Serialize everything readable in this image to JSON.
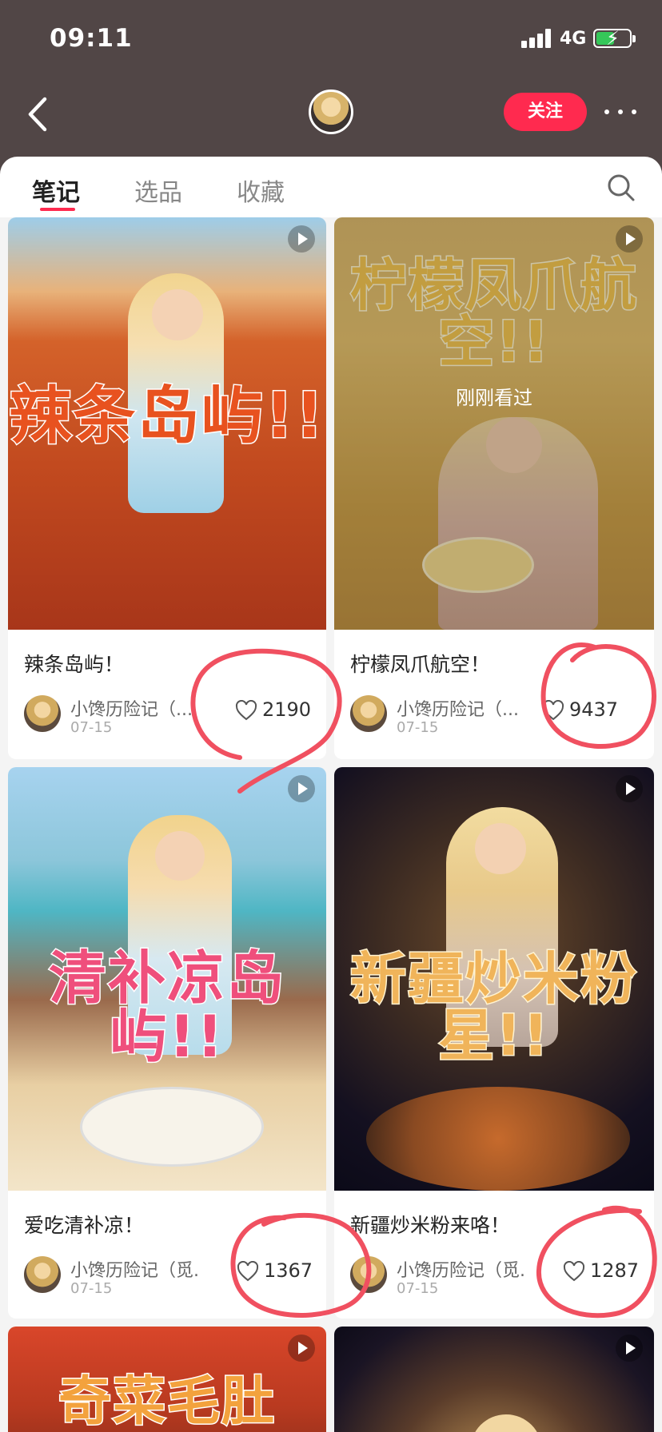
{
  "status_bar": {
    "time": "09:11",
    "network": "4G"
  },
  "header": {
    "follow_label": "关注"
  },
  "tabs": [
    {
      "label": "笔记",
      "active": true
    },
    {
      "label": "选品",
      "active": false
    },
    {
      "label": "收藏",
      "active": false
    }
  ],
  "posts": [
    {
      "cover_text": "辣条岛屿!!",
      "title": "辣条岛屿！",
      "author": "小馋历险记（...",
      "date": "07-15",
      "likes": "2190",
      "video": true,
      "seen_label": "",
      "accent": "#e8521f"
    },
    {
      "cover_text": "柠檬凤爪航空!!",
      "title": "柠檬凤爪航空！",
      "author": "小馋历险记（...",
      "date": "07-15",
      "likes": "9437",
      "video": true,
      "seen_label": "刚刚看过",
      "accent": "#d6a74a"
    },
    {
      "cover_text": "清补凉岛屿!!",
      "title": "爱吃清补凉！",
      "author": "小馋历险记（觅...",
      "date": "07-15",
      "likes": "1367",
      "video": true,
      "seen_label": "",
      "accent": "#ef4f7c"
    },
    {
      "cover_text": "新疆炒米粉星!!",
      "title": "新疆炒米粉来咯！",
      "author": "小馋历险记（觅...",
      "date": "07-15",
      "likes": "1287",
      "video": true,
      "seen_label": "",
      "accent": "#e59a3b"
    },
    {
      "cover_text": "奇菜毛肚",
      "title": "",
      "author": "",
      "date": "",
      "likes": "",
      "video": true,
      "seen_label": "",
      "accent": "#c6451f"
    },
    {
      "cover_text": "",
      "title": "",
      "author": "",
      "date": "",
      "likes": "",
      "video": true,
      "seen_label": "",
      "accent": "#2a2030"
    }
  ],
  "colors": {
    "header_bg": "#514646",
    "brand_red": "#ff2a4f",
    "annotation_red": "#f05060"
  }
}
